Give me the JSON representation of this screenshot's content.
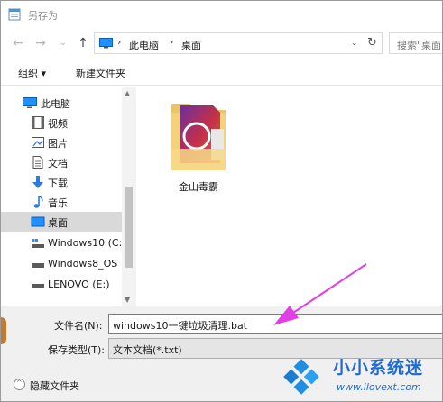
{
  "window": {
    "title": "另存为"
  },
  "navbar": {
    "back_label": "←",
    "forward_label": "→",
    "recent_label": "⌄",
    "up_label": "↑",
    "breadcrumb": [
      "此电脑",
      "桌面"
    ],
    "search_placeholder": "搜索\"桌面"
  },
  "toolbar": {
    "organize_label": "组织 ▾",
    "new_folder_label": "新建文件夹"
  },
  "sidebar": {
    "items": [
      {
        "label": "此电脑",
        "icon": "pc-icon"
      },
      {
        "label": "视频",
        "icon": "video-icon"
      },
      {
        "label": "图片",
        "icon": "pictures-icon"
      },
      {
        "label": "文档",
        "icon": "documents-icon"
      },
      {
        "label": "下载",
        "icon": "download-icon"
      },
      {
        "label": "音乐",
        "icon": "music-icon"
      },
      {
        "label": "桌面",
        "icon": "desktop-icon",
        "selected": true
      },
      {
        "label": "Windows10 (C:",
        "icon": "drive-icon"
      },
      {
        "label": "Windows8_OS",
        "icon": "drive-icon"
      },
      {
        "label": "LENOVO (E:)",
        "icon": "drive-icon"
      }
    ]
  },
  "content": {
    "files": [
      {
        "label": "金山毒霸",
        "icon": "folder-icon"
      }
    ]
  },
  "fields": {
    "filename_label": "文件名(N):",
    "filename_value": "windows10一键垃圾清理.bat",
    "filetype_label": "保存类型(T):",
    "filetype_value": "文本文档(*.txt)"
  },
  "footer": {
    "hide_folders_label": "隐藏文件夹"
  },
  "watermark": {
    "name": "小小系统迷",
    "url": "www.ilovext.com"
  },
  "colors": {
    "selection": "#cce8ff",
    "accent": "#1f6bd1",
    "arrow": "#e040e6"
  }
}
